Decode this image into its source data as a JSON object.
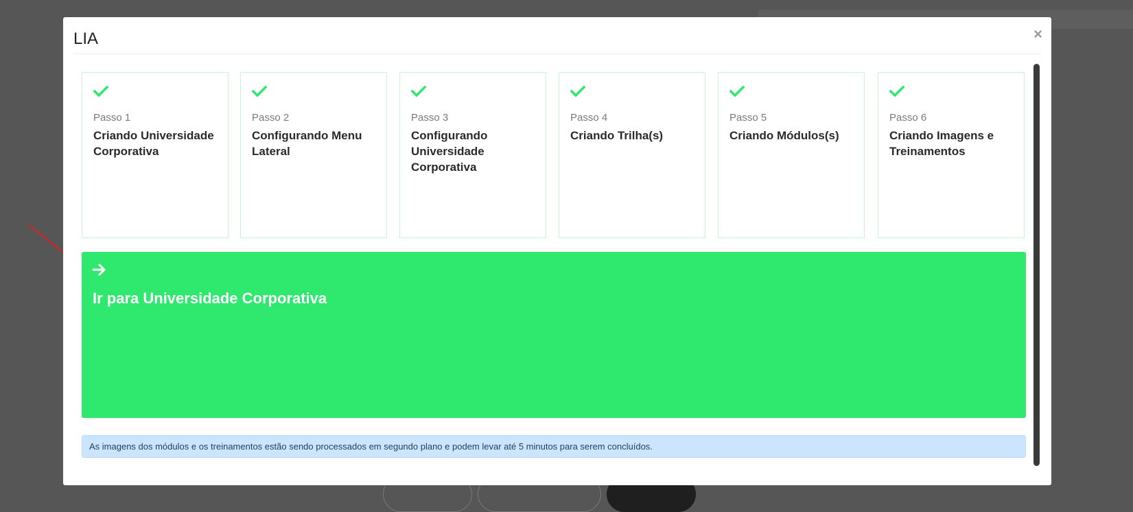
{
  "modal": {
    "title": "LIA",
    "close": "×"
  },
  "steps": [
    {
      "number": "Passo 1",
      "title": "Criando Universidade Corporativa",
      "status_icon": "check-icon"
    },
    {
      "number": "Passo 2",
      "title": "Configurando Menu Lateral",
      "status_icon": "check-icon"
    },
    {
      "number": "Passo 3",
      "title": "Configurando Universidade Corporativa",
      "status_icon": "check-icon"
    },
    {
      "number": "Passo 4",
      "title": "Criando Trilha(s)",
      "status_icon": "check-icon"
    },
    {
      "number": "Passo 5",
      "title": "Criando Módulos(s)",
      "status_icon": "check-icon"
    },
    {
      "number": "Passo 6",
      "title": "Criando Imagens e Treinamentos",
      "status_icon": "check-icon"
    }
  ],
  "goto": {
    "label": "Ir para Universidade Corporativa",
    "icon": "arrow-right-icon"
  },
  "notice": "As imagens dos módulos e os treinamentos estão sendo processados em segundo plano e podem levar até 5 minutos para serem concluídos.",
  "colors": {
    "accent_green": "#2fe86e",
    "card_border": "#c8f5d6",
    "info_bg": "#cce5ff",
    "overlay": "#565656",
    "annotation": "#e02020"
  }
}
